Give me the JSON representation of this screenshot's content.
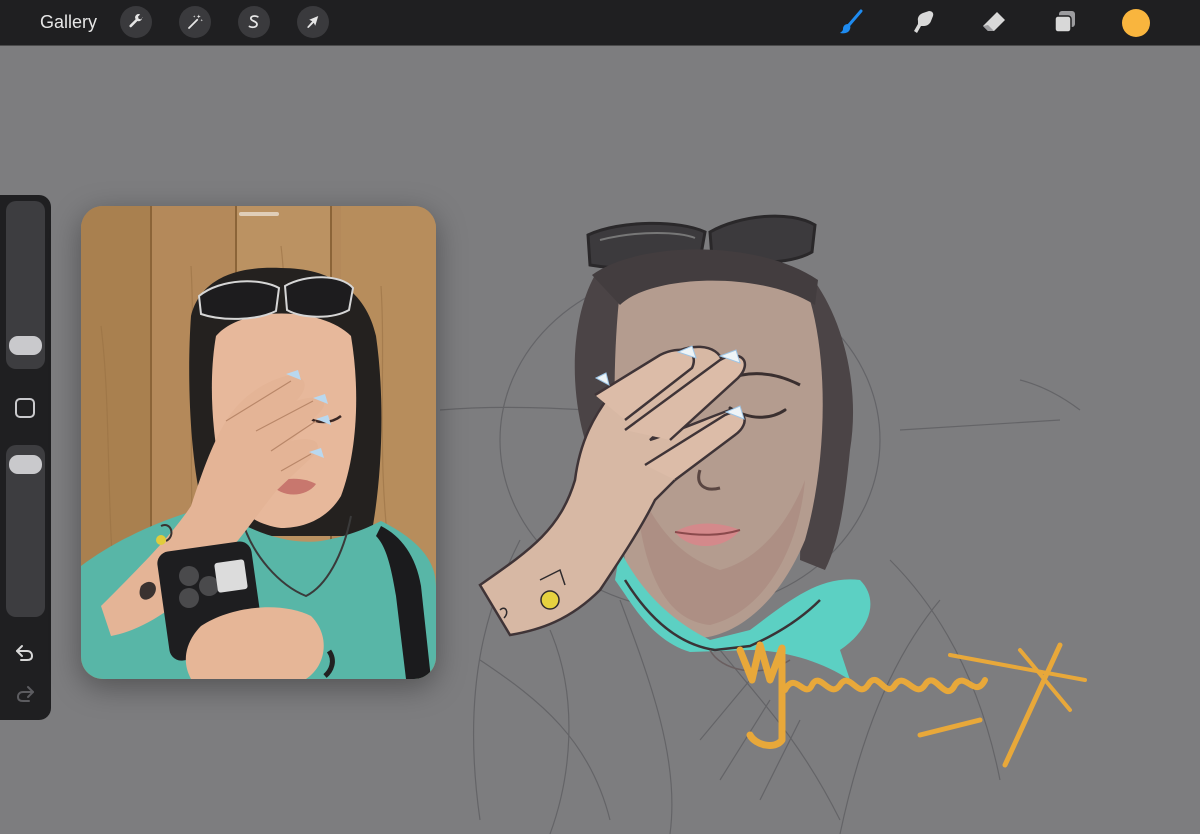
{
  "toolbar": {
    "gallery_label": "Gallery",
    "left_tools": [
      {
        "name": "actions",
        "icon": "wrench-icon"
      },
      {
        "name": "adjustments",
        "icon": "magic-wand-icon"
      },
      {
        "name": "selection",
        "icon": "selection-s-icon"
      },
      {
        "name": "transform",
        "icon": "arrow-cursor-icon"
      }
    ],
    "right_tools": [
      {
        "name": "brush",
        "icon": "brush-icon",
        "active": true
      },
      {
        "name": "smudge",
        "icon": "smudge-finger-icon",
        "active": false
      },
      {
        "name": "eraser",
        "icon": "eraser-icon",
        "active": false
      },
      {
        "name": "layers",
        "icon": "layers-icon",
        "active": false
      }
    ],
    "current_color": "#F9B53E",
    "active_tool_color": "#1E8BF0"
  },
  "sidebar": {
    "brush_size": 0.08,
    "opacity": 0.95,
    "modify_icon": "square-icon",
    "undo_icon": "undo-arrow-icon",
    "redo_icon": "redo-arrow-icon",
    "redo_enabled": false
  },
  "reference": {
    "visible": true
  },
  "canvas": {
    "background_color": "#7D7D7F",
    "signature_color": "#E8A83A"
  }
}
